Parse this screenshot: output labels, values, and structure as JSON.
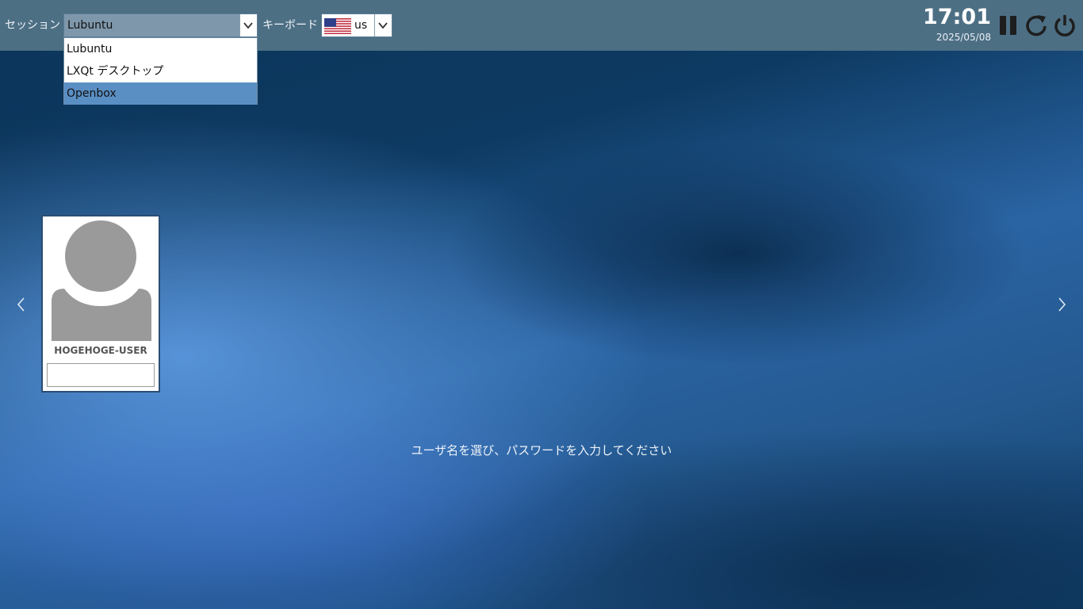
{
  "topbar": {
    "session_label": "セッション",
    "session_selected": "Lubuntu",
    "keyboard_label": "キーボード",
    "keyboard_value": "us",
    "keyboard_flag_icon": "us-flag-icon"
  },
  "session_dropdown": {
    "options": [
      "Lubuntu",
      "LXQt デスクトップ",
      "Openbox"
    ],
    "highlighted": "Openbox"
  },
  "clock": {
    "time": "17:01",
    "date": "2025/05/08"
  },
  "system_buttons": {
    "suspend_icon": "pause-icon",
    "restart_icon": "restart-icon",
    "shutdown_icon": "power-icon"
  },
  "user": {
    "name": "HOGEHOGE-USER",
    "password_value": ""
  },
  "prompt": "ユーザ名を選び、パスワードを入力してください",
  "colors": {
    "topbar": "#4d6f84",
    "selection": "#5a8fc4",
    "card_border": "#2a4d74"
  }
}
